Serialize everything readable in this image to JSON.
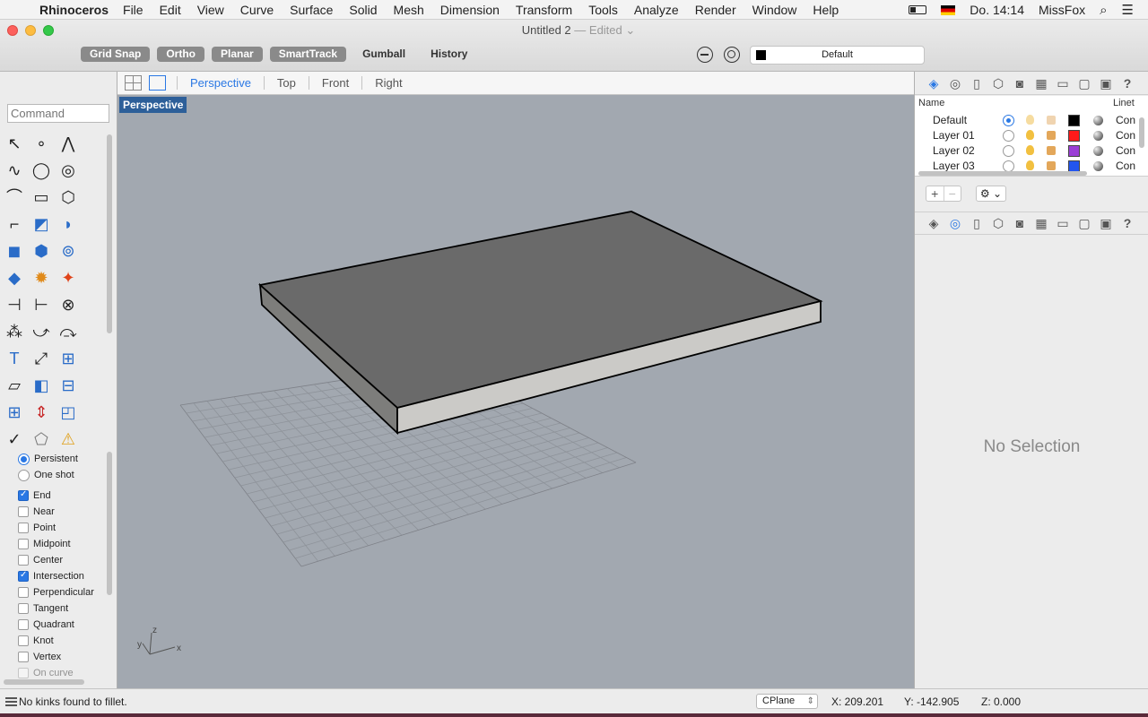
{
  "menubar": {
    "app": "Rhinoceros",
    "items": [
      "File",
      "Edit",
      "View",
      "Curve",
      "Surface",
      "Solid",
      "Mesh",
      "Dimension",
      "Transform",
      "Tools",
      "Analyze",
      "Render",
      "Window",
      "Help"
    ],
    "clock": "Do. 14:14",
    "user": "MissFox"
  },
  "window": {
    "title": "Untitled 2",
    "edited": "— Edited ⌄",
    "toggles": [
      {
        "label": "Grid Snap",
        "on": true
      },
      {
        "label": "Ortho",
        "on": true
      },
      {
        "label": "Planar",
        "on": true
      },
      {
        "label": "SmartTrack",
        "on": true
      },
      {
        "label": "Gumball",
        "on": false
      },
      {
        "label": "History",
        "on": false
      }
    ],
    "current_layer": "Default"
  },
  "command": {
    "placeholder": "Command"
  },
  "viewport_tabs": [
    "Perspective",
    "Top",
    "Front",
    "Right"
  ],
  "active_viewport": "Perspective",
  "osnaps": {
    "mode": [
      {
        "label": "Persistent",
        "selected": true
      },
      {
        "label": "One shot",
        "selected": false
      }
    ],
    "items": [
      {
        "label": "End",
        "checked": true
      },
      {
        "label": "Near",
        "checked": false
      },
      {
        "label": "Point",
        "checked": false
      },
      {
        "label": "Midpoint",
        "checked": false
      },
      {
        "label": "Center",
        "checked": false
      },
      {
        "label": "Intersection",
        "checked": true
      },
      {
        "label": "Perpendicular",
        "checked": false
      },
      {
        "label": "Tangent",
        "checked": false
      },
      {
        "label": "Quadrant",
        "checked": false
      },
      {
        "label": "Knot",
        "checked": false
      },
      {
        "label": "Vertex",
        "checked": false
      },
      {
        "label": "On curve",
        "checked": false
      }
    ]
  },
  "layers": {
    "headers": {
      "name": "Name",
      "linetype": "Linet"
    },
    "rows": [
      {
        "name": "Default",
        "current": true,
        "color": "#000000",
        "linetype": "Con"
      },
      {
        "name": "Layer 01",
        "current": false,
        "color": "#ff1a1a",
        "linetype": "Con"
      },
      {
        "name": "Layer 02",
        "current": false,
        "color": "#9b3fd6",
        "linetype": "Con"
      },
      {
        "name": "Layer 03",
        "current": false,
        "color": "#2255ee",
        "linetype": "Con"
      }
    ]
  },
  "properties": {
    "empty_label": "No Selection"
  },
  "status": {
    "message": "No kinks found to fillet.",
    "cplane": "CPlane",
    "x": "X: 209.201",
    "y": "Y: -142.905",
    "z": "Z: 0.000"
  },
  "axis_labels": {
    "x": "x",
    "y": "y",
    "z": "z"
  },
  "colors": {
    "accent": "#2a78e4",
    "viewport_bg": "#a2a8b0",
    "viewport_label": "#2d5f99"
  }
}
